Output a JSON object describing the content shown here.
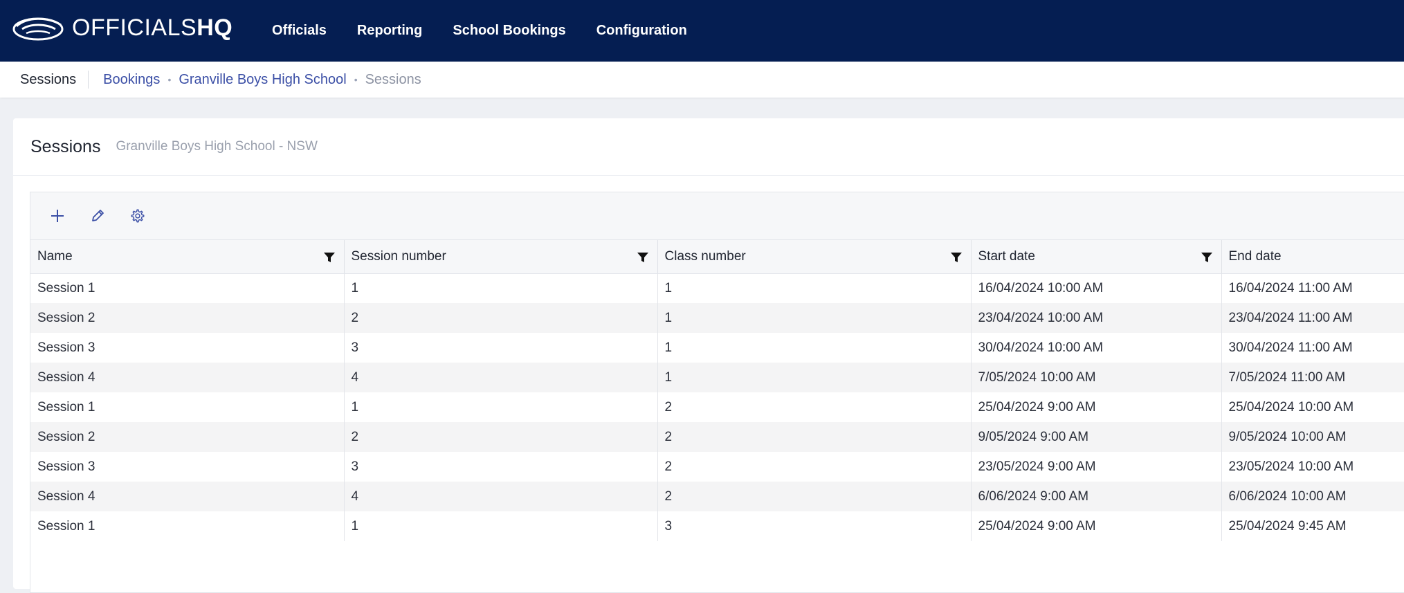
{
  "app": {
    "logo_light": "OFFICIALS",
    "logo_bold": "HQ"
  },
  "nav": {
    "items": [
      {
        "label": "Officials"
      },
      {
        "label": "Reporting"
      },
      {
        "label": "School Bookings"
      },
      {
        "label": "Configuration"
      }
    ]
  },
  "breadcrumb": {
    "page_label": "Sessions",
    "links": [
      "Bookings",
      "Granville Boys High School"
    ],
    "current": "Sessions",
    "separator": "•"
  },
  "card": {
    "title": "Sessions",
    "subtitle": "Granville Boys High School - NSW"
  },
  "toolbar": {
    "icons": [
      "plus-icon",
      "pencil-icon",
      "gear-icon"
    ]
  },
  "table": {
    "columns": [
      "Name",
      "Session number",
      "Class number",
      "Start date",
      "End date"
    ],
    "rows": [
      [
        "Session 1",
        "1",
        "1",
        "16/04/2024 10:00 AM",
        "16/04/2024 11:00 AM"
      ],
      [
        "Session 2",
        "2",
        "1",
        "23/04/2024 10:00 AM",
        "23/04/2024 11:00 AM"
      ],
      [
        "Session 3",
        "3",
        "1",
        "30/04/2024 10:00 AM",
        "30/04/2024 11:00 AM"
      ],
      [
        "Session 4",
        "4",
        "1",
        "7/05/2024 10:00 AM",
        "7/05/2024 11:00 AM"
      ],
      [
        "Session 1",
        "1",
        "2",
        "25/04/2024 9:00 AM",
        "25/04/2024 10:00 AM"
      ],
      [
        "Session 2",
        "2",
        "2",
        "9/05/2024 9:00 AM",
        "9/05/2024 10:00 AM"
      ],
      [
        "Session 3",
        "3",
        "2",
        "23/05/2024 9:00 AM",
        "23/05/2024 10:00 AM"
      ],
      [
        "Session 4",
        "4",
        "2",
        "6/06/2024 9:00 AM",
        "6/06/2024 10:00 AM"
      ],
      [
        "Session 1",
        "1",
        "3",
        "25/04/2024 9:00 AM",
        "25/04/2024 9:45 AM"
      ]
    ]
  },
  "colors": {
    "nav_bg": "#051e52",
    "link": "#3b4fa6",
    "row_alt": "#f4f4f5"
  }
}
